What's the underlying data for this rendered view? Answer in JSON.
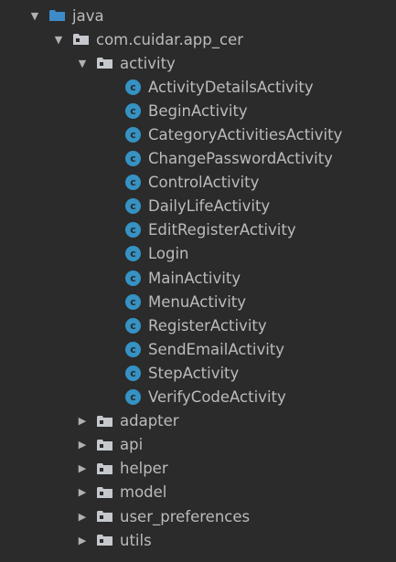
{
  "tree": {
    "root": {
      "label": "java",
      "arrow": "▼",
      "icon": "folder-blue-icon"
    },
    "package": {
      "label": "com.cuidar.app_cer",
      "arrow": "▼",
      "icon": "package-icon"
    },
    "activity_pkg": {
      "label": "activity",
      "arrow": "▼",
      "icon": "package-icon"
    },
    "class_marker": "c",
    "classes": [
      "ActivityDetailsActivity",
      "BeginActivity",
      "CategoryActivitiesActivity",
      "ChangePasswordActivity",
      "ControlActivity",
      "DailyLifeActivity",
      "EditRegisterActivity",
      "Login",
      "MainActivity",
      "MenuActivity",
      "RegisterActivity",
      "SendEmailActivity",
      "StepActivity",
      "VerifyCodeActivity"
    ],
    "collapsed_arrow": "▶",
    "collapsed_packages": [
      "adapter",
      "api",
      "helper",
      "model",
      "user_preferences",
      "utils"
    ]
  },
  "colors": {
    "background": "#2b2b2b",
    "text": "#bbbbbb",
    "class_icon": "#3592c4",
    "java_folder": "#3d8bc9",
    "package_folder": "#c5c8cc"
  }
}
